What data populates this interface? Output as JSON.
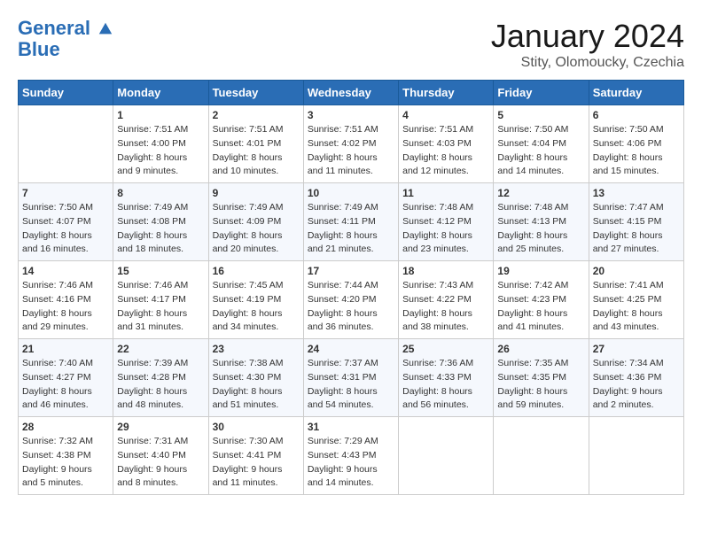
{
  "logo": {
    "line1": "General",
    "line2": "Blue"
  },
  "title": "January 2024",
  "subtitle": "Stity, Olomoucky, Czechia",
  "days_of_week": [
    "Sunday",
    "Monday",
    "Tuesday",
    "Wednesday",
    "Thursday",
    "Friday",
    "Saturday"
  ],
  "weeks": [
    [
      {
        "day": "",
        "sunrise": "",
        "sunset": "",
        "daylight": ""
      },
      {
        "day": "1",
        "sunrise": "7:51 AM",
        "sunset": "4:00 PM",
        "daylight": "8 hours and 9 minutes."
      },
      {
        "day": "2",
        "sunrise": "7:51 AM",
        "sunset": "4:01 PM",
        "daylight": "8 hours and 10 minutes."
      },
      {
        "day": "3",
        "sunrise": "7:51 AM",
        "sunset": "4:02 PM",
        "daylight": "8 hours and 11 minutes."
      },
      {
        "day": "4",
        "sunrise": "7:51 AM",
        "sunset": "4:03 PM",
        "daylight": "8 hours and 12 minutes."
      },
      {
        "day": "5",
        "sunrise": "7:50 AM",
        "sunset": "4:04 PM",
        "daylight": "8 hours and 14 minutes."
      },
      {
        "day": "6",
        "sunrise": "7:50 AM",
        "sunset": "4:06 PM",
        "daylight": "8 hours and 15 minutes."
      }
    ],
    [
      {
        "day": "7",
        "sunrise": "7:50 AM",
        "sunset": "4:07 PM",
        "daylight": "8 hours and 16 minutes."
      },
      {
        "day": "8",
        "sunrise": "7:49 AM",
        "sunset": "4:08 PM",
        "daylight": "8 hours and 18 minutes."
      },
      {
        "day": "9",
        "sunrise": "7:49 AM",
        "sunset": "4:09 PM",
        "daylight": "8 hours and 20 minutes."
      },
      {
        "day": "10",
        "sunrise": "7:49 AM",
        "sunset": "4:11 PM",
        "daylight": "8 hours and 21 minutes."
      },
      {
        "day": "11",
        "sunrise": "7:48 AM",
        "sunset": "4:12 PM",
        "daylight": "8 hours and 23 minutes."
      },
      {
        "day": "12",
        "sunrise": "7:48 AM",
        "sunset": "4:13 PM",
        "daylight": "8 hours and 25 minutes."
      },
      {
        "day": "13",
        "sunrise": "7:47 AM",
        "sunset": "4:15 PM",
        "daylight": "8 hours and 27 minutes."
      }
    ],
    [
      {
        "day": "14",
        "sunrise": "7:46 AM",
        "sunset": "4:16 PM",
        "daylight": "8 hours and 29 minutes."
      },
      {
        "day": "15",
        "sunrise": "7:46 AM",
        "sunset": "4:17 PM",
        "daylight": "8 hours and 31 minutes."
      },
      {
        "day": "16",
        "sunrise": "7:45 AM",
        "sunset": "4:19 PM",
        "daylight": "8 hours and 34 minutes."
      },
      {
        "day": "17",
        "sunrise": "7:44 AM",
        "sunset": "4:20 PM",
        "daylight": "8 hours and 36 minutes."
      },
      {
        "day": "18",
        "sunrise": "7:43 AM",
        "sunset": "4:22 PM",
        "daylight": "8 hours and 38 minutes."
      },
      {
        "day": "19",
        "sunrise": "7:42 AM",
        "sunset": "4:23 PM",
        "daylight": "8 hours and 41 minutes."
      },
      {
        "day": "20",
        "sunrise": "7:41 AM",
        "sunset": "4:25 PM",
        "daylight": "8 hours and 43 minutes."
      }
    ],
    [
      {
        "day": "21",
        "sunrise": "7:40 AM",
        "sunset": "4:27 PM",
        "daylight": "8 hours and 46 minutes."
      },
      {
        "day": "22",
        "sunrise": "7:39 AM",
        "sunset": "4:28 PM",
        "daylight": "8 hours and 48 minutes."
      },
      {
        "day": "23",
        "sunrise": "7:38 AM",
        "sunset": "4:30 PM",
        "daylight": "8 hours and 51 minutes."
      },
      {
        "day": "24",
        "sunrise": "7:37 AM",
        "sunset": "4:31 PM",
        "daylight": "8 hours and 54 minutes."
      },
      {
        "day": "25",
        "sunrise": "7:36 AM",
        "sunset": "4:33 PM",
        "daylight": "8 hours and 56 minutes."
      },
      {
        "day": "26",
        "sunrise": "7:35 AM",
        "sunset": "4:35 PM",
        "daylight": "8 hours and 59 minutes."
      },
      {
        "day": "27",
        "sunrise": "7:34 AM",
        "sunset": "4:36 PM",
        "daylight": "9 hours and 2 minutes."
      }
    ],
    [
      {
        "day": "28",
        "sunrise": "7:32 AM",
        "sunset": "4:38 PM",
        "daylight": "9 hours and 5 minutes."
      },
      {
        "day": "29",
        "sunrise": "7:31 AM",
        "sunset": "4:40 PM",
        "daylight": "9 hours and 8 minutes."
      },
      {
        "day": "30",
        "sunrise": "7:30 AM",
        "sunset": "4:41 PM",
        "daylight": "9 hours and 11 minutes."
      },
      {
        "day": "31",
        "sunrise": "7:29 AM",
        "sunset": "4:43 PM",
        "daylight": "9 hours and 14 minutes."
      },
      {
        "day": "",
        "sunrise": "",
        "sunset": "",
        "daylight": ""
      },
      {
        "day": "",
        "sunrise": "",
        "sunset": "",
        "daylight": ""
      },
      {
        "day": "",
        "sunrise": "",
        "sunset": "",
        "daylight": ""
      }
    ]
  ]
}
